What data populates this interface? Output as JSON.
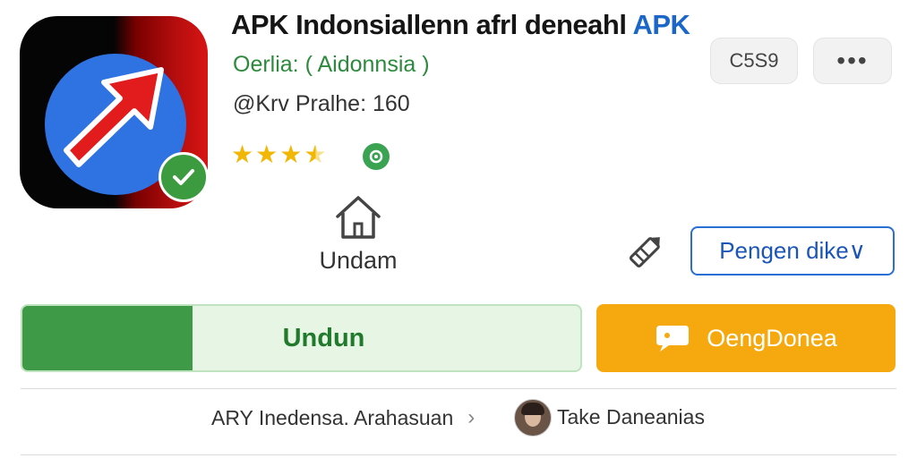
{
  "app": {
    "title_main": "APK Indonsiallenn afrl deneahl",
    "title_accent": "APK",
    "developer": "Oerlia: ( Aidonnsia )",
    "meta_line": "@Krv Pralhe: 160",
    "rating_stars": 3.5
  },
  "header_actions": {
    "code_chip": "C5S9",
    "more_label": "•••"
  },
  "quick_actions": {
    "home_label": "Undam",
    "dropdown_label": "Pengen dike∨"
  },
  "buttons": {
    "install_label": "Undun",
    "secondary_label": "OengDonea"
  },
  "footer": {
    "left_text": "ARY Inedensa. Arahasuan",
    "chevron": "›",
    "right_text": "Take Daneanias"
  },
  "icons": {
    "app": "red-arrow-app-icon",
    "verified": "check-badge-icon",
    "rating_badge": "green-badge-icon",
    "home": "home-icon",
    "edit": "pencil-icon",
    "chat": "chat-bubble-icon"
  },
  "colors": {
    "accent_blue": "#1b66c9",
    "developer_green": "#2c8a3c",
    "install_green": "#3e9a47",
    "secondary_orange": "#f5a90f",
    "star_yellow": "#f2b705"
  }
}
